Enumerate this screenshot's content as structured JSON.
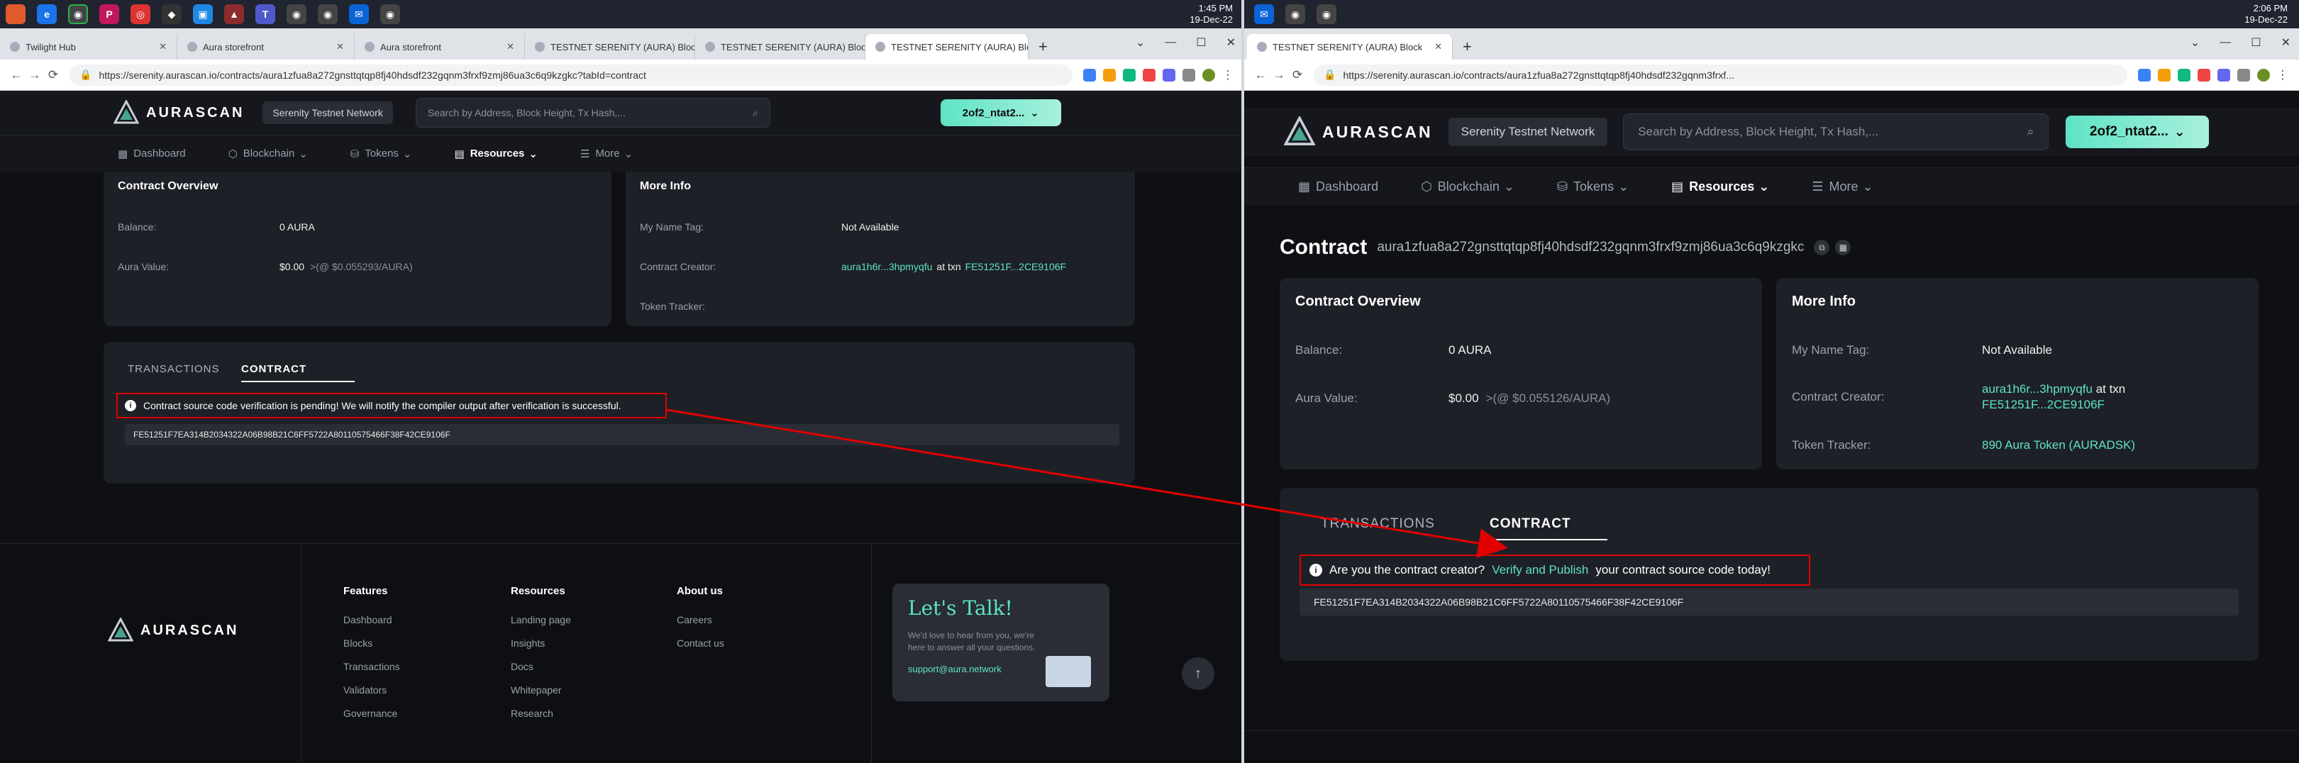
{
  "left": {
    "clock": {
      "time": "1:45 PM",
      "date": "19-Dec-22"
    },
    "tabs": [
      "Twilight Hub",
      "Aura storefront",
      "Aura storefront",
      "TESTNET SERENITY (AURA) Block",
      "TESTNET SERENITY (AURA) Block",
      "TESTNET SERENITY (AURA) Block"
    ],
    "url": "https://serenity.aurascan.io/contracts/aura1zfua8a272gnsttqtqp8fj40hdsdf232gqnm3frxf9zmj86ua3c6q9kzgkc?tabId=contract",
    "logo": "AURASCAN",
    "network": "Serenity Testnet Network",
    "search_placeholder": "Search by Address, Block Height, Tx Hash,...",
    "wallet": "2of2_ntat2...",
    "nav": [
      "Dashboard",
      "Blockchain",
      "Tokens",
      "Resources",
      "More"
    ],
    "overview": {
      "title": "Contract Overview",
      "balance_label": "Balance:",
      "balance": "0 AURA",
      "value_label": "Aura Value:",
      "value": "$0.00",
      "value_sub": ">(@ $0.055293/AURA)"
    },
    "more_info": {
      "title": "More Info",
      "name_tag_label": "My Name Tag:",
      "name_tag": "Not Available",
      "creator_label": "Contract Creator:",
      "creator": "aura1h6r...3hpmyqfu",
      "creator_mid": "at txn",
      "creator_tx": "FE51251F...2CE9106F",
      "tracker_label": "Token Tracker:"
    },
    "tab_transactions": "TRANSACTIONS",
    "tab_contract": "CONTRACT",
    "alert": "Contract source code verification is pending! We will notify the compiler output after verification is successful.",
    "hash": "FE51251F7EA314B2034322A06B98B21C6FF5722A80110575466F38F42CE9106F",
    "footer": {
      "features": {
        "title": "Features",
        "items": [
          "Dashboard",
          "Blocks",
          "Transactions",
          "Validators",
          "Governance"
        ]
      },
      "resources": {
        "title": "Resources",
        "items": [
          "Landing page",
          "Insights",
          "Docs",
          "Whitepaper",
          "Research"
        ]
      },
      "about": {
        "title": "About us",
        "items": [
          "Careers",
          "Contact us"
        ]
      },
      "talk_title": "Let's Talk!",
      "talk_text": "We'd love to hear from you, we're here to answer all your questions.",
      "talk_email": "support@aura.network"
    }
  },
  "right": {
    "clock": {
      "time": "2:06 PM",
      "date": "19-Dec-22"
    },
    "tab": "TESTNET SERENITY (AURA) Block",
    "url": "https://serenity.aurascan.io/contracts/aura1zfua8a272gnsttqtqp8fj40hdsdf232gqnm3frxf...",
    "logo": "AURASCAN",
    "network": "Serenity Testnet Network",
    "search_placeholder": "Search by Address, Block Height, Tx Hash,...",
    "wallet": "2of2_ntat2...",
    "nav": [
      "Dashboard",
      "Blockchain",
      "Tokens",
      "Resources",
      "More"
    ],
    "contract_heading": "Contract",
    "contract_address": "aura1zfua8a272gnsttqtqp8fj40hdsdf232gqnm3frxf9zmj86ua3c6q9kzgkc",
    "overview": {
      "title": "Contract Overview",
      "balance_label": "Balance:",
      "balance": "0 AURA",
      "value_label": "Aura Value:",
      "value": "$0.00",
      "value_sub": ">(@ $0.055126/AURA)"
    },
    "more_info": {
      "title": "More Info",
      "name_tag_label": "My Name Tag:",
      "name_tag": "Not Available",
      "creator_label": "Contract Creator:",
      "creator": "aura1h6r...3hpmyqfu",
      "creator_mid": "at txn",
      "creator_tx": "FE51251F...2CE9106F",
      "tracker_label": "Token Tracker:",
      "tracker": "890 Aura Token (AURADSK)"
    },
    "tab_transactions": "TRANSACTIONS",
    "tab_contract": "CONTRACT",
    "alert_pre": "Are you the contract creator?",
    "alert_link": "Verify and Publish",
    "alert_post": "your contract source code today!",
    "hash": "FE51251F7EA314B2034322A06B98B21C6FF5722A80110575466F38F42CE9106F"
  },
  "colors": {
    "accent": "#5ee3c4",
    "annotation": "#e00000",
    "card": "#1e2027",
    "bg": "#0f1014"
  }
}
